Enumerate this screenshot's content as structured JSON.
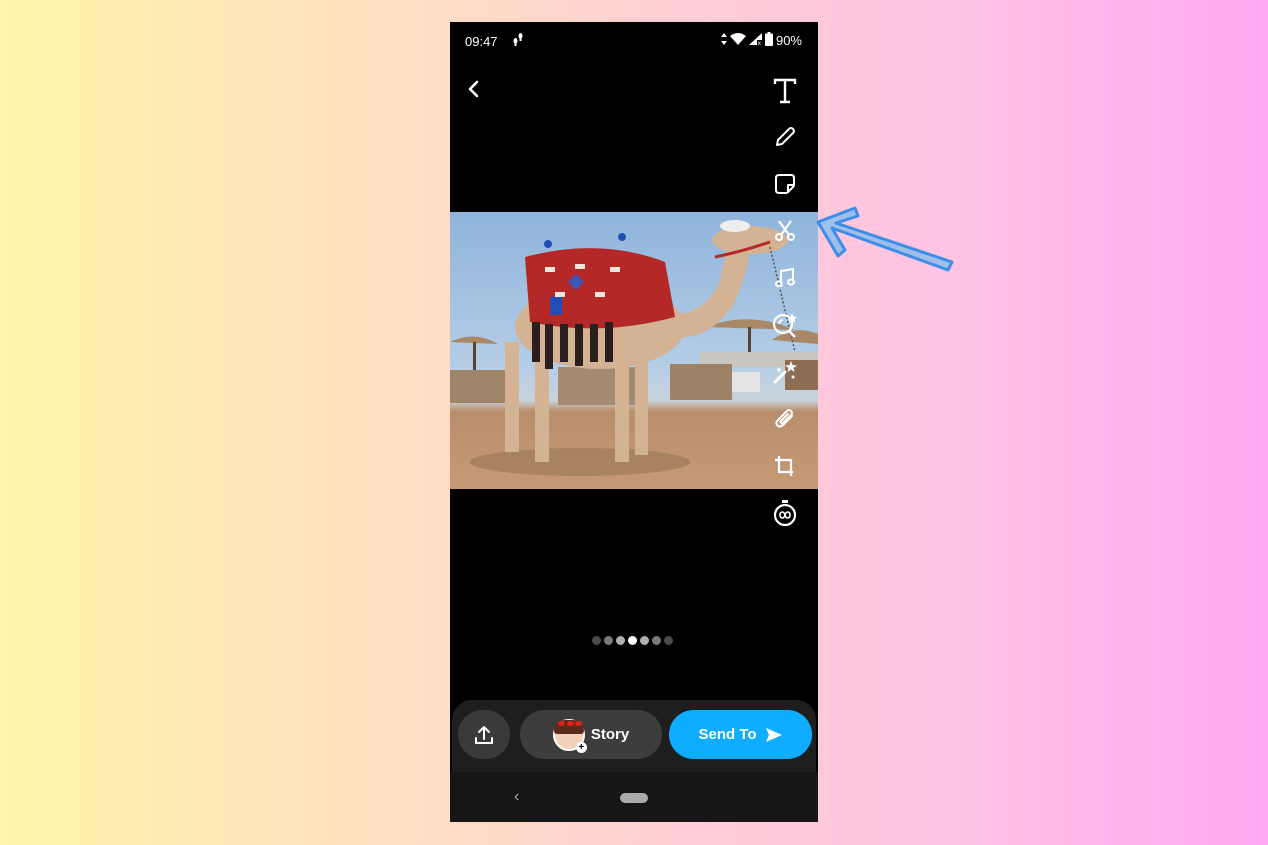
{
  "status_bar": {
    "time": "09:47",
    "battery": "90%",
    "icons": [
      "footsteps-icon",
      "data-arrows-icon",
      "wifi-icon",
      "signal-icon",
      "battery-icon"
    ]
  },
  "header": {
    "back_icon": "chevron-left-icon"
  },
  "toolbar": {
    "tools": [
      {
        "name": "text-tool",
        "icon": "text-icon"
      },
      {
        "name": "draw-tool",
        "icon": "pencil-icon"
      },
      {
        "name": "sticker-tool",
        "icon": "sticker-icon"
      },
      {
        "name": "scissors-tool",
        "icon": "scissors-icon"
      },
      {
        "name": "music-tool",
        "icon": "music-note-icon"
      },
      {
        "name": "lens-tool",
        "icon": "lens-search-icon"
      },
      {
        "name": "magic-tool",
        "icon": "magic-wand-icon"
      },
      {
        "name": "attachment-tool",
        "icon": "paperclip-icon"
      },
      {
        "name": "crop-tool",
        "icon": "crop-icon"
      },
      {
        "name": "timer-tool",
        "icon": "timer-infinity-icon"
      }
    ]
  },
  "photo": {
    "subject": "Decorated camel standing on a sandy beach with straw umbrellas"
  },
  "filter_dots": {
    "count": 7,
    "active_index": 3
  },
  "bottom_bar": {
    "upload_icon": "upload-icon",
    "story_label": "Story",
    "send_label": "Send To",
    "send_color": "#0fadff"
  },
  "nav_bar": {
    "back_glyph": "‹"
  },
  "annotation": {
    "arrow_color": "#3d8ee8",
    "arrow_points_to": "scissors-tool"
  }
}
